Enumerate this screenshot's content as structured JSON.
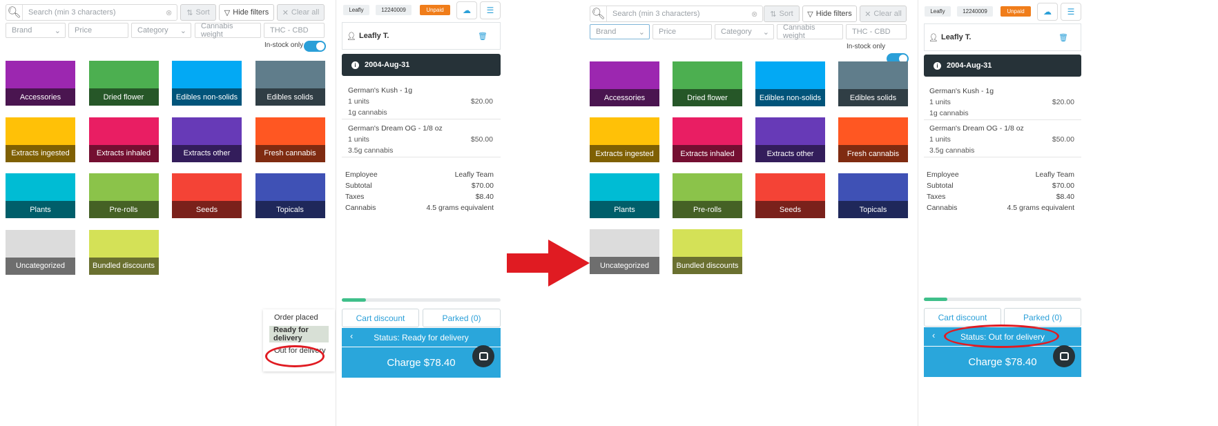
{
  "search": {
    "placeholder": "Search (min 3 characters)",
    "icon": "search-icon"
  },
  "toolbar": {
    "sort": "Sort",
    "hide_filters": "Hide filters",
    "clear_all": "Clear all"
  },
  "filters": {
    "brand": "Brand",
    "price": "Price",
    "category": "Category",
    "weight": "Cannabis weight",
    "thc": "THC - CBD",
    "instock": "In-stock only"
  },
  "categories": [
    {
      "label": "Accessories",
      "color": "#9c27b0",
      "band": "#4a1550"
    },
    {
      "label": "Dried flower",
      "color": "#4caf50",
      "band": "#265728"
    },
    {
      "label": "Edibles non-solids",
      "color": "#03a9f4",
      "band": "#01547a"
    },
    {
      "label": "Edibles solids",
      "color": "#607d8b",
      "band": "#303e45"
    },
    {
      "label": "Extracts ingested",
      "color": "#ffc107",
      "band": "#7f6003"
    },
    {
      "label": "Extracts inhaled",
      "color": "#e91e63",
      "band": "#740f31"
    },
    {
      "label": "Extracts other",
      "color": "#673ab7",
      "band": "#331d5b"
    },
    {
      "label": "Fresh cannabis",
      "color": "#ff5722",
      "band": "#7f2b11"
    },
    {
      "label": "Plants",
      "color": "#00bcd4",
      "band": "#005e6a"
    },
    {
      "label": "Pre-rolls",
      "color": "#8bc34a",
      "band": "#456125"
    },
    {
      "label": "Seeds",
      "color": "#f44336",
      "band": "#7a211b"
    },
    {
      "label": "Topicals",
      "color": "#3f51b5",
      "band": "#1f285a"
    },
    {
      "label": "Uncategorized",
      "color": "#dcdcdc",
      "band": "#6e6e6e"
    },
    {
      "label": "Bundled discounts",
      "color": "#d4e157",
      "band": "#6a7030"
    }
  ],
  "order": {
    "store_chip": "Leafly",
    "order_number": "12240009",
    "payment_status": "Unpaid",
    "customer": "Leafly T.",
    "date": "2004-Aug-31",
    "items": [
      {
        "name": "German's Kush - 1g",
        "qty": "1 units",
        "price": "$20.00",
        "note": "1g cannabis"
      },
      {
        "name": "German's Dream OG - 1/8 oz",
        "qty": "1 units",
        "price": "$50.00",
        "note": "3.5g cannabis"
      }
    ],
    "summary": [
      {
        "label": "Employee",
        "value": "Leafly Team"
      },
      {
        "label": "Subtotal",
        "value": "$70.00"
      },
      {
        "label": "Taxes",
        "value": "$8.40"
      },
      {
        "label": "Cannabis",
        "value": "4.5 grams equivalent"
      }
    ],
    "progress_fraction": 0.15,
    "cart_discount": "Cart discount",
    "parked": "Parked (0)",
    "charge": "Charge $78.40"
  },
  "before": {
    "status_label": "Status: Ready for delivery",
    "menu": [
      "Order placed",
      "Ready for delivery",
      "Out for delivery"
    ]
  },
  "after": {
    "status_label": "Status: Out for delivery"
  },
  "arrow_color": "#e01b22"
}
